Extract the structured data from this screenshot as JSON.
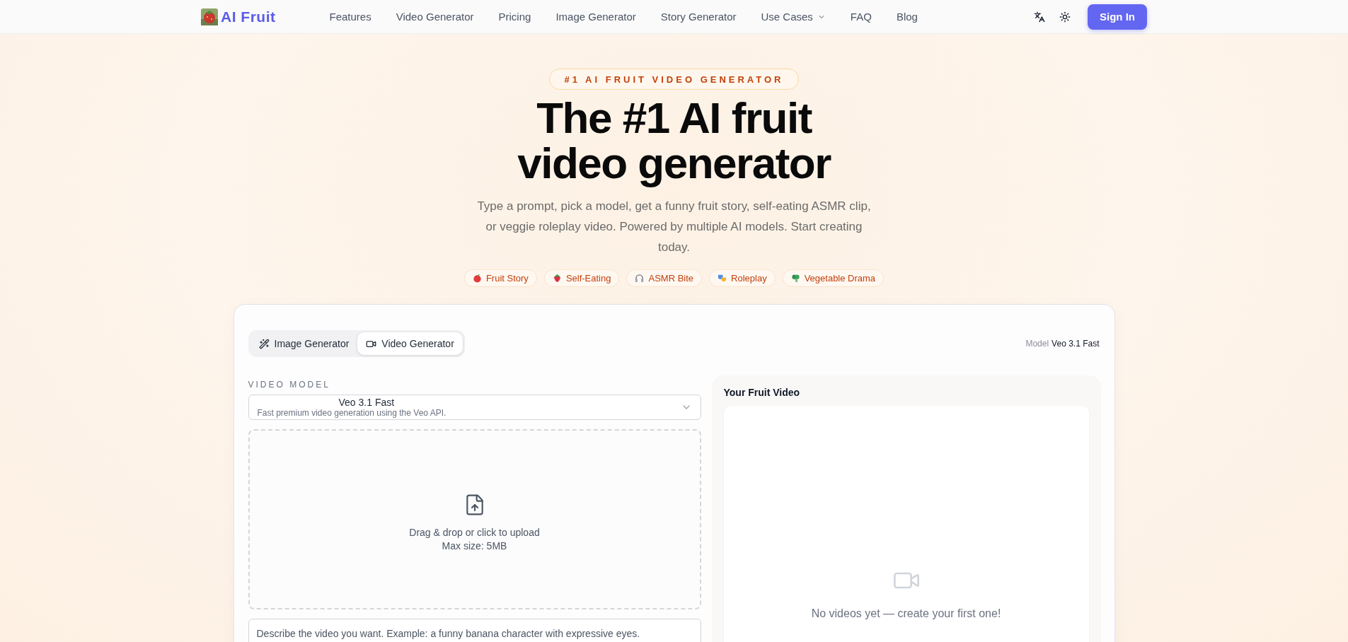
{
  "nav": {
    "logo": {
      "text": "AI Fruit"
    },
    "links": [
      {
        "label": "Features",
        "dropdown": false
      },
      {
        "label": "Video Generator",
        "dropdown": false
      },
      {
        "label": "Pricing",
        "dropdown": false
      },
      {
        "label": "Image Generator",
        "dropdown": false
      },
      {
        "label": "Story Generator",
        "dropdown": false
      },
      {
        "label": "Use Cases",
        "dropdown": true
      },
      {
        "label": "FAQ",
        "dropdown": false
      },
      {
        "label": "Blog",
        "dropdown": false
      }
    ],
    "sign_in": "Sign In"
  },
  "hero": {
    "badge": "#1 AI FRUIT VIDEO GENERATOR",
    "title": "The #1 AI fruit video generator",
    "subtitle": "Type a prompt, pick a model, get a funny fruit story, self-eating ASMR clip, or veggie roleplay video. Powered by multiple AI models. Start creating today.",
    "chips": [
      {
        "label": "Fruit Story",
        "kind": "apple"
      },
      {
        "label": "Self-Eating",
        "kind": "strawberry"
      },
      {
        "label": "ASMR Bite",
        "kind": "headphones"
      },
      {
        "label": "Roleplay",
        "kind": "masks"
      },
      {
        "label": "Vegetable Drama",
        "kind": "broccoli"
      }
    ]
  },
  "generator": {
    "tabs": [
      {
        "label": "Image Generator",
        "selected": false
      },
      {
        "label": "Video Generator",
        "kind": "video",
        "selected": true
      }
    ],
    "model_label": "Model",
    "model_value": "Veo 3.1 Fast",
    "field_label": "VIDEO MODEL",
    "select": {
      "value": "Veo 3.1 Fast",
      "description": "Fast premium video generation using the Veo API."
    },
    "upload": {
      "text": "Drag & drop or click to upload",
      "limit": "Max size: 5MB"
    },
    "prompt": {
      "placeholder": "Describe the video you want. Example: a funny banana character with expressive eyes."
    },
    "result": {
      "title": "Your Fruit Video",
      "empty": "No videos yet — create your first one!"
    }
  }
}
